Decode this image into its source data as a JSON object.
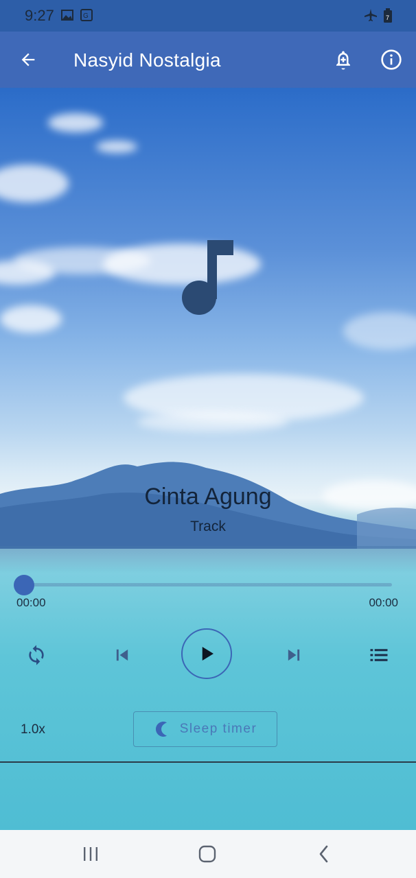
{
  "status_bar": {
    "time": "9:27",
    "icons": [
      "image-icon",
      "translate-icon",
      "airplane-icon",
      "battery-icon"
    ],
    "battery_level": "7"
  },
  "app_bar": {
    "title": "Nasyid Nostalgia",
    "back_icon": "arrow-left-icon",
    "alarm_icon": "bell-plus-icon",
    "info_icon": "info-icon"
  },
  "player": {
    "artwork_icon": "music-note-icon",
    "track_title": "Cinta Agung",
    "track_subtitle": "Track",
    "progress": 0,
    "time_elapsed": "00:00",
    "time_total": "00:00",
    "controls": [
      "repeat-icon",
      "previous-icon",
      "play-icon",
      "next-icon",
      "playlist-icon"
    ],
    "speed": "1.0x",
    "sleep_timer_label": "Sleep timer",
    "sleep_timer_icon": "moon-icon"
  },
  "nav_bar": {
    "buttons": [
      "recent-apps-icon",
      "home-icon",
      "back-icon"
    ]
  },
  "colors": {
    "accent": "#3b66b6",
    "app_bar": "#3f69b8",
    "status_bar": "#2d5ea8",
    "text_dark": "#13243a"
  }
}
